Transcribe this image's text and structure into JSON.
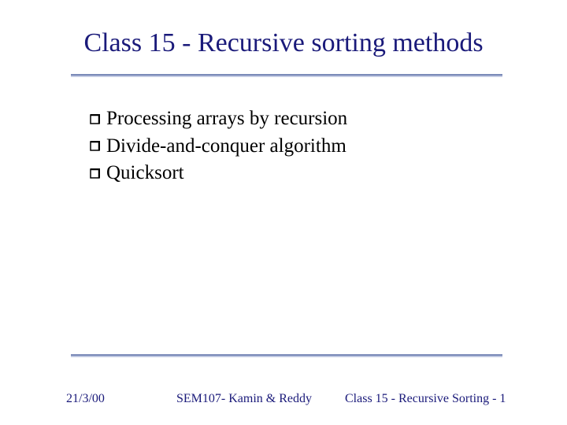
{
  "title": "Class 15 - Recursive sorting methods",
  "bullets": [
    "Processing arrays by recursion",
    "Divide-and-conquer algorithm",
    "Quicksort"
  ],
  "footer": {
    "date": "21/3/00",
    "center": "SEM107- Kamin & Reddy",
    "right": "Class 15 - Recursive Sorting - 1"
  }
}
